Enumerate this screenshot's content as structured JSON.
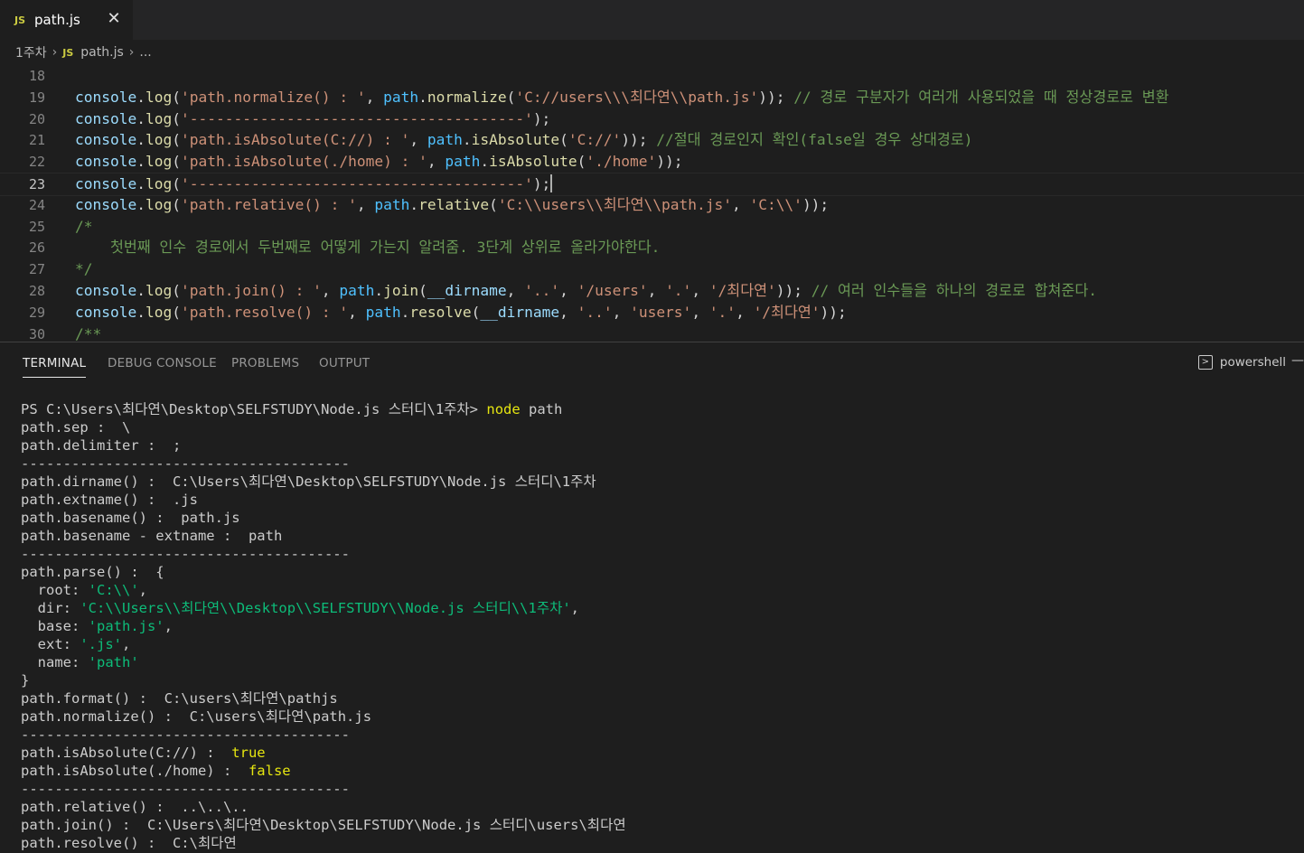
{
  "tab": {
    "badge": "JS",
    "title": "path.js",
    "close": "✕"
  },
  "breadcrumb": {
    "folder": "1주차",
    "badge": "JS",
    "file": "path.js",
    "more": "..."
  },
  "editor": {
    "active_line": 23,
    "lines": [
      {
        "num": "18",
        "tokens": []
      },
      {
        "num": "19",
        "tokens": [
          {
            "c": "t-obj",
            "t": "console"
          },
          {
            "c": "t-pun",
            "t": "."
          },
          {
            "c": "t-fn",
            "t": "log"
          },
          {
            "c": "t-pun",
            "t": "("
          },
          {
            "c": "t-str",
            "t": "'path.normalize() : '"
          },
          {
            "c": "t-pun",
            "t": ", "
          },
          {
            "c": "t-path",
            "t": "path"
          },
          {
            "c": "t-pun",
            "t": "."
          },
          {
            "c": "t-fn",
            "t": "normalize"
          },
          {
            "c": "t-pun",
            "t": "("
          },
          {
            "c": "t-str",
            "t": "'C://users\\\\\\최다연\\\\path.js'"
          },
          {
            "c": "t-pun",
            "t": ")); "
          },
          {
            "c": "t-com",
            "t": "// 경로 구분자가 여러개 사용되었을 때 정상경로로 변환"
          }
        ]
      },
      {
        "num": "20",
        "tokens": [
          {
            "c": "t-obj",
            "t": "console"
          },
          {
            "c": "t-pun",
            "t": "."
          },
          {
            "c": "t-fn",
            "t": "log"
          },
          {
            "c": "t-pun",
            "t": "("
          },
          {
            "c": "t-str",
            "t": "'--------------------------------------'"
          },
          {
            "c": "t-pun",
            "t": ");"
          }
        ]
      },
      {
        "num": "21",
        "tokens": [
          {
            "c": "t-obj",
            "t": "console"
          },
          {
            "c": "t-pun",
            "t": "."
          },
          {
            "c": "t-fn",
            "t": "log"
          },
          {
            "c": "t-pun",
            "t": "("
          },
          {
            "c": "t-str",
            "t": "'path.isAbsolute(C://) : '"
          },
          {
            "c": "t-pun",
            "t": ", "
          },
          {
            "c": "t-path",
            "t": "path"
          },
          {
            "c": "t-pun",
            "t": "."
          },
          {
            "c": "t-fn",
            "t": "isAbsolute"
          },
          {
            "c": "t-pun",
            "t": "("
          },
          {
            "c": "t-str",
            "t": "'C://'"
          },
          {
            "c": "t-pun",
            "t": ")); "
          },
          {
            "c": "t-com",
            "t": "//절대 경로인지 확인(false일 경우 상대경로)"
          }
        ]
      },
      {
        "num": "22",
        "tokens": [
          {
            "c": "t-obj",
            "t": "console"
          },
          {
            "c": "t-pun",
            "t": "."
          },
          {
            "c": "t-fn",
            "t": "log"
          },
          {
            "c": "t-pun",
            "t": "("
          },
          {
            "c": "t-str",
            "t": "'path.isAbsolute(./home) : '"
          },
          {
            "c": "t-pun",
            "t": ", "
          },
          {
            "c": "t-path",
            "t": "path"
          },
          {
            "c": "t-pun",
            "t": "."
          },
          {
            "c": "t-fn",
            "t": "isAbsolute"
          },
          {
            "c": "t-pun",
            "t": "("
          },
          {
            "c": "t-str",
            "t": "'./home'"
          },
          {
            "c": "t-pun",
            "t": "));"
          }
        ]
      },
      {
        "num": "23",
        "tokens": [
          {
            "c": "t-obj",
            "t": "console"
          },
          {
            "c": "t-pun",
            "t": "."
          },
          {
            "c": "t-fn",
            "t": "log"
          },
          {
            "c": "t-pun",
            "t": "("
          },
          {
            "c": "t-str",
            "t": "'--------------------------------------'"
          },
          {
            "c": "t-pun",
            "t": ");"
          }
        ]
      },
      {
        "num": "24",
        "tokens": [
          {
            "c": "t-obj",
            "t": "console"
          },
          {
            "c": "t-pun",
            "t": "."
          },
          {
            "c": "t-fn",
            "t": "log"
          },
          {
            "c": "t-pun",
            "t": "("
          },
          {
            "c": "t-str",
            "t": "'path.relative() : '"
          },
          {
            "c": "t-pun",
            "t": ", "
          },
          {
            "c": "t-path",
            "t": "path"
          },
          {
            "c": "t-pun",
            "t": "."
          },
          {
            "c": "t-fn",
            "t": "relative"
          },
          {
            "c": "t-pun",
            "t": "("
          },
          {
            "c": "t-str",
            "t": "'C:\\\\users\\\\최다연\\\\path.js'"
          },
          {
            "c": "t-pun",
            "t": ", "
          },
          {
            "c": "t-str",
            "t": "'C:\\\\'"
          },
          {
            "c": "t-pun",
            "t": "));"
          }
        ]
      },
      {
        "num": "25",
        "tokens": [
          {
            "c": "t-com",
            "t": "/*"
          }
        ]
      },
      {
        "num": "26",
        "tokens": [
          {
            "c": "t-com",
            "t": "    첫번째 인수 경로에서 두번째로 어떻게 가는지 알려줌. 3단계 상위로 올라가야한다."
          }
        ]
      },
      {
        "num": "27",
        "tokens": [
          {
            "c": "t-com",
            "t": "*/"
          }
        ]
      },
      {
        "num": "28",
        "tokens": [
          {
            "c": "t-obj",
            "t": "console"
          },
          {
            "c": "t-pun",
            "t": "."
          },
          {
            "c": "t-fn",
            "t": "log"
          },
          {
            "c": "t-pun",
            "t": "("
          },
          {
            "c": "t-str",
            "t": "'path.join() : '"
          },
          {
            "c": "t-pun",
            "t": ", "
          },
          {
            "c": "t-path",
            "t": "path"
          },
          {
            "c": "t-pun",
            "t": "."
          },
          {
            "c": "t-fn",
            "t": "join"
          },
          {
            "c": "t-pun",
            "t": "("
          },
          {
            "c": "t-id",
            "t": "__dirname"
          },
          {
            "c": "t-pun",
            "t": ", "
          },
          {
            "c": "t-str",
            "t": "'..'"
          },
          {
            "c": "t-pun",
            "t": ", "
          },
          {
            "c": "t-str",
            "t": "'/users'"
          },
          {
            "c": "t-pun",
            "t": ", "
          },
          {
            "c": "t-str",
            "t": "'.'"
          },
          {
            "c": "t-pun",
            "t": ", "
          },
          {
            "c": "t-str",
            "t": "'/최다연'"
          },
          {
            "c": "t-pun",
            "t": ")); "
          },
          {
            "c": "t-com",
            "t": "// 여러 인수들을 하나의 경로로 합쳐준다."
          }
        ]
      },
      {
        "num": "29",
        "tokens": [
          {
            "c": "t-obj",
            "t": "console"
          },
          {
            "c": "t-pun",
            "t": "."
          },
          {
            "c": "t-fn",
            "t": "log"
          },
          {
            "c": "t-pun",
            "t": "("
          },
          {
            "c": "t-str",
            "t": "'path.resolve() : '"
          },
          {
            "c": "t-pun",
            "t": ", "
          },
          {
            "c": "t-path",
            "t": "path"
          },
          {
            "c": "t-pun",
            "t": "."
          },
          {
            "c": "t-fn",
            "t": "resolve"
          },
          {
            "c": "t-pun",
            "t": "("
          },
          {
            "c": "t-id",
            "t": "__dirname"
          },
          {
            "c": "t-pun",
            "t": ", "
          },
          {
            "c": "t-str",
            "t": "'..'"
          },
          {
            "c": "t-pun",
            "t": ", "
          },
          {
            "c": "t-str",
            "t": "'users'"
          },
          {
            "c": "t-pun",
            "t": ", "
          },
          {
            "c": "t-str",
            "t": "'.'"
          },
          {
            "c": "t-pun",
            "t": ", "
          },
          {
            "c": "t-str",
            "t": "'/최다연'"
          },
          {
            "c": "t-pun",
            "t": "));"
          }
        ]
      },
      {
        "num": "30",
        "tokens": [
          {
            "c": "t-com",
            "t": "/**"
          }
        ]
      }
    ]
  },
  "panel": {
    "tabs": [
      "TERMINAL",
      "DEBUG CONSOLE",
      "PROBLEMS",
      "OUTPUT"
    ],
    "active_tab": "TERMINAL",
    "shell": "powershell",
    "more": "—"
  },
  "terminal": [
    [
      {
        "t": "PS C:\\Users\\최다연\\Desktop\\SELFSTUDY\\Node.js 스터디\\1주차> "
      },
      {
        "c": "tk-yel",
        "t": "node"
      },
      {
        "t": " path"
      }
    ],
    [
      {
        "t": "path.sep :  \\"
      }
    ],
    [
      {
        "t": "path.delimiter :  ;"
      }
    ],
    [
      {
        "t": "---------------------------------------"
      }
    ],
    [
      {
        "t": "path.dirname() :  C:\\Users\\최다연\\Desktop\\SELFSTUDY\\Node.js 스터디\\1주차"
      }
    ],
    [
      {
        "t": "path.extname() :  .js"
      }
    ],
    [
      {
        "t": "path.basename() :  path.js"
      }
    ],
    [
      {
        "t": "path.basename - extname :  path"
      }
    ],
    [
      {
        "t": "---------------------------------------"
      }
    ],
    [
      {
        "t": "path.parse() :  {"
      }
    ],
    [
      {
        "t": "  root: "
      },
      {
        "c": "tk-grn",
        "t": "'C:\\\\'"
      },
      {
        "t": ","
      }
    ],
    [
      {
        "t": "  dir: "
      },
      {
        "c": "tk-grn",
        "t": "'C:\\\\Users\\\\최다연\\\\Desktop\\\\SELFSTUDY\\\\Node.js 스터디\\\\1주차'"
      },
      {
        "t": ","
      }
    ],
    [
      {
        "t": "  base: "
      },
      {
        "c": "tk-grn",
        "t": "'path.js'"
      },
      {
        "t": ","
      }
    ],
    [
      {
        "t": "  ext: "
      },
      {
        "c": "tk-grn",
        "t": "'.js'"
      },
      {
        "t": ","
      }
    ],
    [
      {
        "t": "  name: "
      },
      {
        "c": "tk-grn",
        "t": "'path'"
      }
    ],
    [
      {
        "t": "}"
      }
    ],
    [
      {
        "t": "path.format() :  C:\\users\\최다연\\pathjs"
      }
    ],
    [
      {
        "t": "path.normalize() :  C:\\users\\최다연\\path.js"
      }
    ],
    [
      {
        "t": "---------------------------------------"
      }
    ],
    [
      {
        "t": "path.isAbsolute(C://) :  "
      },
      {
        "c": "tk-yel",
        "t": "true"
      }
    ],
    [
      {
        "t": "path.isAbsolute(./home) :  "
      },
      {
        "c": "tk-yel",
        "t": "false"
      }
    ],
    [
      {
        "t": "---------------------------------------"
      }
    ],
    [
      {
        "t": "path.relative() :  ..\\..\\.."
      }
    ],
    [
      {
        "t": "path.join() :  C:\\Users\\최다연\\Desktop\\SELFSTUDY\\Node.js 스터디\\users\\최다연"
      }
    ],
    [
      {
        "t": "path.resolve() :  C:\\최다연"
      }
    ]
  ]
}
